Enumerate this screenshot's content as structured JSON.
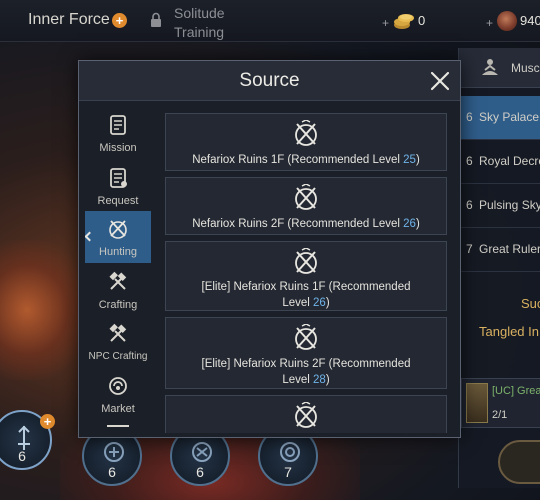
{
  "topbar": {
    "inner_force": "Inner Force",
    "plus": "+",
    "solitude_line1": "Solitude",
    "solitude_line2": "Training",
    "resource1_value": "0",
    "resource2_value": "940"
  },
  "right_panel": {
    "header_label": "Musc",
    "items": [
      {
        "num": "6",
        "text": "Sky Palace"
      },
      {
        "num": "6",
        "text": "Royal Decre"
      },
      {
        "num": "6",
        "text": "Pulsing Sky"
      },
      {
        "num": "7",
        "text": "Great Ruler"
      }
    ],
    "suc": "Suc",
    "tangled": "Tangled In",
    "card_label": "[UC] Great",
    "card_count": "2/1"
  },
  "skills": [
    {
      "level": "6"
    },
    {
      "level": "6"
    },
    {
      "level": "6"
    },
    {
      "level": "7"
    }
  ],
  "dialog": {
    "title": "Source",
    "tabs": [
      {
        "label": "Mission",
        "icon": "scroll-icon"
      },
      {
        "label": "Request",
        "icon": "scroll-icon"
      },
      {
        "label": "Hunting",
        "icon": "crossed-swords-icon"
      },
      {
        "label": "Crafting",
        "icon": "crossed-hammers-icon"
      },
      {
        "label": "NPC Crafting",
        "icon": "crossed-hammers-icon"
      },
      {
        "label": "Market",
        "icon": "market-icon"
      }
    ],
    "entries": [
      {
        "line1": "Nefariox Ruins 1F (Recommended Level ",
        "level": "25",
        "suffix": ")"
      },
      {
        "line1": "Nefariox Ruins 2F (Recommended Level ",
        "level": "26",
        "suffix": ")"
      },
      {
        "line1": "[Elite] Nefariox Ruins 1F (Recommended",
        "line2": "Level ",
        "level": "26",
        "suffix": ")"
      },
      {
        "line1": "[Elite] Nefariox Ruins 2F (Recommended",
        "line2": "Level ",
        "level": "28",
        "suffix": ")"
      }
    ]
  }
}
